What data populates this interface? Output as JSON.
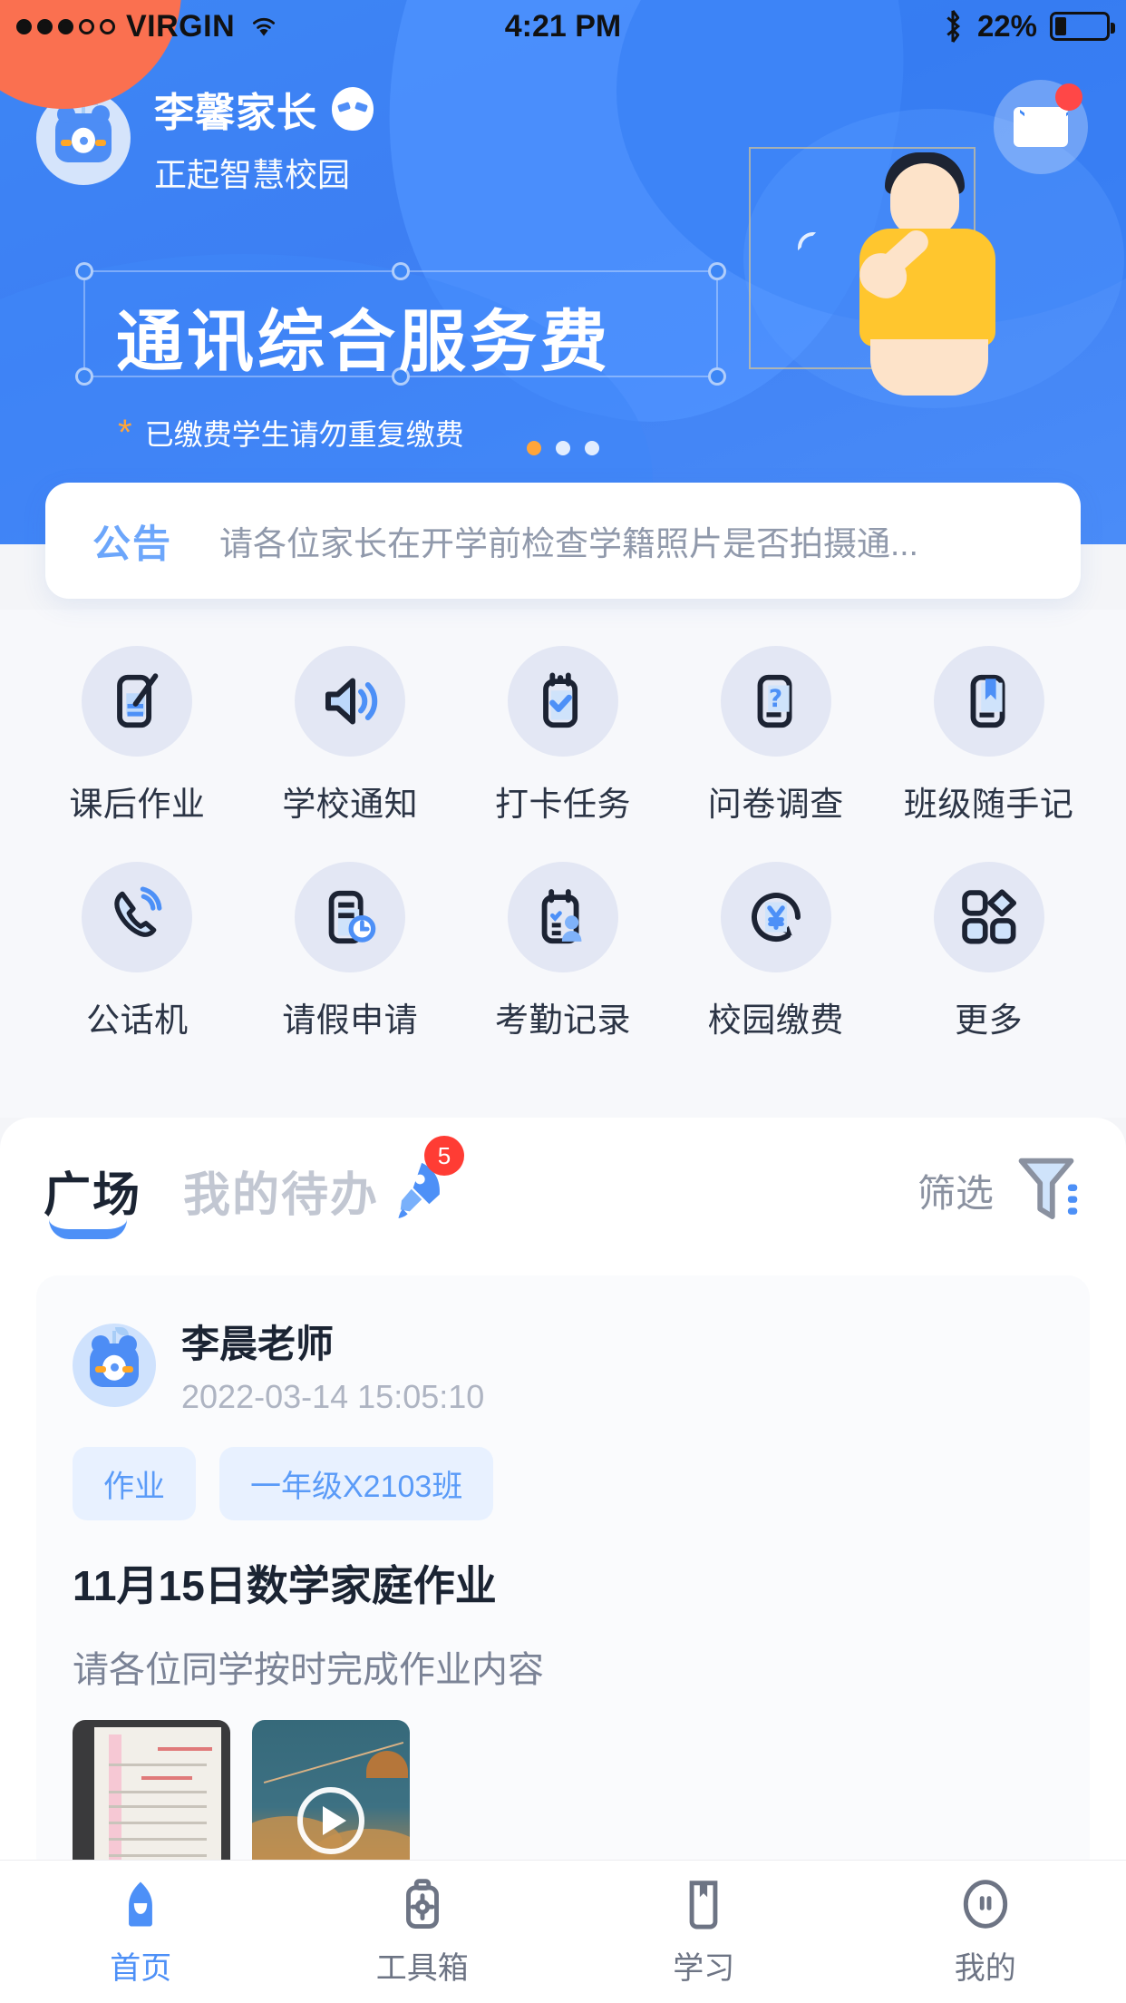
{
  "status_bar": {
    "carrier": "VIRGIN",
    "signal_dots_filled": 3,
    "signal_dots_total": 5,
    "wifi_icon": "wifi-icon",
    "time": "4:21 PM",
    "bluetooth_icon": "bluetooth-icon",
    "battery_percent": "22%",
    "battery_level": 22
  },
  "header": {
    "avatar_icon": "user-avatar-icon",
    "user_name": "李馨家长",
    "mood_icon": "mood-face-icon",
    "school_name": "正起智慧校园",
    "mail_icon": "mail-icon",
    "mail_has_unread": true
  },
  "banner": {
    "title": "通讯综合服务费",
    "note_star": "*",
    "note": "已缴费学生请勿重复缴费",
    "carousel_dots": 3,
    "carousel_active_index": 0,
    "illustration": "person-waving-illustration"
  },
  "notice": {
    "tag": "公告",
    "text": "请各位家长在开学前检查学籍照片是否拍摄通..."
  },
  "quick_actions": [
    {
      "label": "课后作业",
      "icon": "homework-edit-icon"
    },
    {
      "label": "学校通知",
      "icon": "speaker-announcement-icon"
    },
    {
      "label": "打卡任务",
      "icon": "checkin-task-icon"
    },
    {
      "label": "问卷调查",
      "icon": "questionnaire-icon"
    },
    {
      "label": "班级随手记",
      "icon": "class-notebook-icon"
    },
    {
      "label": "公话机",
      "icon": "phone-call-icon"
    },
    {
      "label": "请假申请",
      "icon": "leave-request-icon"
    },
    {
      "label": "考勤记录",
      "icon": "attendance-record-icon"
    },
    {
      "label": "校园缴费",
      "icon": "campus-payment-icon"
    },
    {
      "label": "更多",
      "icon": "more-grid-icon"
    }
  ],
  "feed": {
    "tabs": [
      {
        "label": "广场",
        "active": true
      },
      {
        "label": "我的待办",
        "active": false,
        "badge": "5",
        "icon": "rocket-icon"
      }
    ],
    "filter": {
      "label": "筛选",
      "icon": "filter-icon"
    },
    "posts": [
      {
        "avatar_icon": "teacher-avatar-icon",
        "author": "李晨老师",
        "time": "2022-03-14 15:05:10",
        "tags": [
          "作业",
          "一年级X2103班"
        ],
        "title": "11月15日数学家庭作业",
        "body": "请各位同学按时完成作业内容",
        "attachments": [
          {
            "type": "image",
            "name": "homework-photo-thumbnail"
          },
          {
            "type": "video",
            "name": "video-thumbnail",
            "play_icon": "play-icon"
          }
        ]
      }
    ]
  },
  "tabbar": [
    {
      "label": "首页",
      "icon": "home-icon",
      "active": true
    },
    {
      "label": "工具箱",
      "icon": "toolbox-icon",
      "active": false
    },
    {
      "label": "学习",
      "icon": "study-book-icon",
      "active": false
    },
    {
      "label": "我的",
      "icon": "profile-icon",
      "active": false
    }
  ],
  "colors": {
    "brand_blue": "#4d90f7",
    "hero_gradient_start": "#3d86f5",
    "accent_orange": "#ffa53a",
    "badge_red": "#ff3c34",
    "page_bg": "#f4f5f8"
  }
}
